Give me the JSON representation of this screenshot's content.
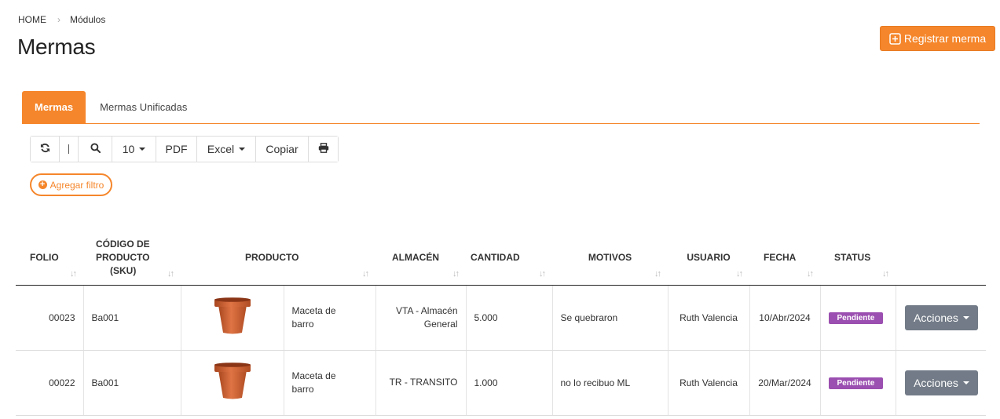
{
  "breadcrumb": {
    "home": "HOME",
    "current": "Módulos"
  },
  "page": {
    "title": "Mermas"
  },
  "header": {
    "register_label": "Registrar merma"
  },
  "tabs": [
    {
      "label": "Mermas",
      "active": true
    },
    {
      "label": "Mermas Unificadas",
      "active": false
    }
  ],
  "toolbar": {
    "refresh_icon": "refresh-icon",
    "search_icon": "search-icon",
    "page_size": "10",
    "pdf": "PDF",
    "excel": "Excel",
    "copy": "Copiar",
    "print_icon": "print-icon"
  },
  "filter": {
    "label": "Agregar filtro"
  },
  "table": {
    "headers": {
      "folio": "FOLIO",
      "sku_line1": "CÓDIGO DE",
      "sku_line2": "PRODUCTO",
      "sku_line3": "(SKU)",
      "producto": "PRODUCTO",
      "almacen": "ALMACÉN",
      "cantidad": "CANTIDAD",
      "motivos": "MOTIVOS",
      "usuario": "USUARIO",
      "fecha": "FECHA",
      "status": "STATUS"
    },
    "rows": [
      {
        "folio": "00023",
        "sku": "Ba001",
        "producto_l1": "Maceta de",
        "producto_l2": "barro",
        "almacen_l1": "VTA - Almacén",
        "almacen_l2": "General",
        "cantidad": "5.000",
        "motivos": "Se quebraron",
        "usuario": "Ruth Valencia",
        "fecha": "10/Abr/2024",
        "status": "Pendiente",
        "acciones": "Acciones"
      },
      {
        "folio": "00022",
        "sku": "Ba001",
        "producto_l1": "Maceta de",
        "producto_l2": "barro",
        "almacen_l1": "TR - TRANSITO",
        "almacen_l2": "",
        "cantidad": "1.000",
        "motivos": "no lo recibuo ML",
        "usuario": "Ruth Valencia",
        "fecha": "20/Mar/2024",
        "status": "Pendiente",
        "acciones": "Acciones"
      }
    ]
  },
  "colors": {
    "accent": "#f5862b",
    "status_pending": "#9b4fb0",
    "actions_button": "#727b87"
  }
}
